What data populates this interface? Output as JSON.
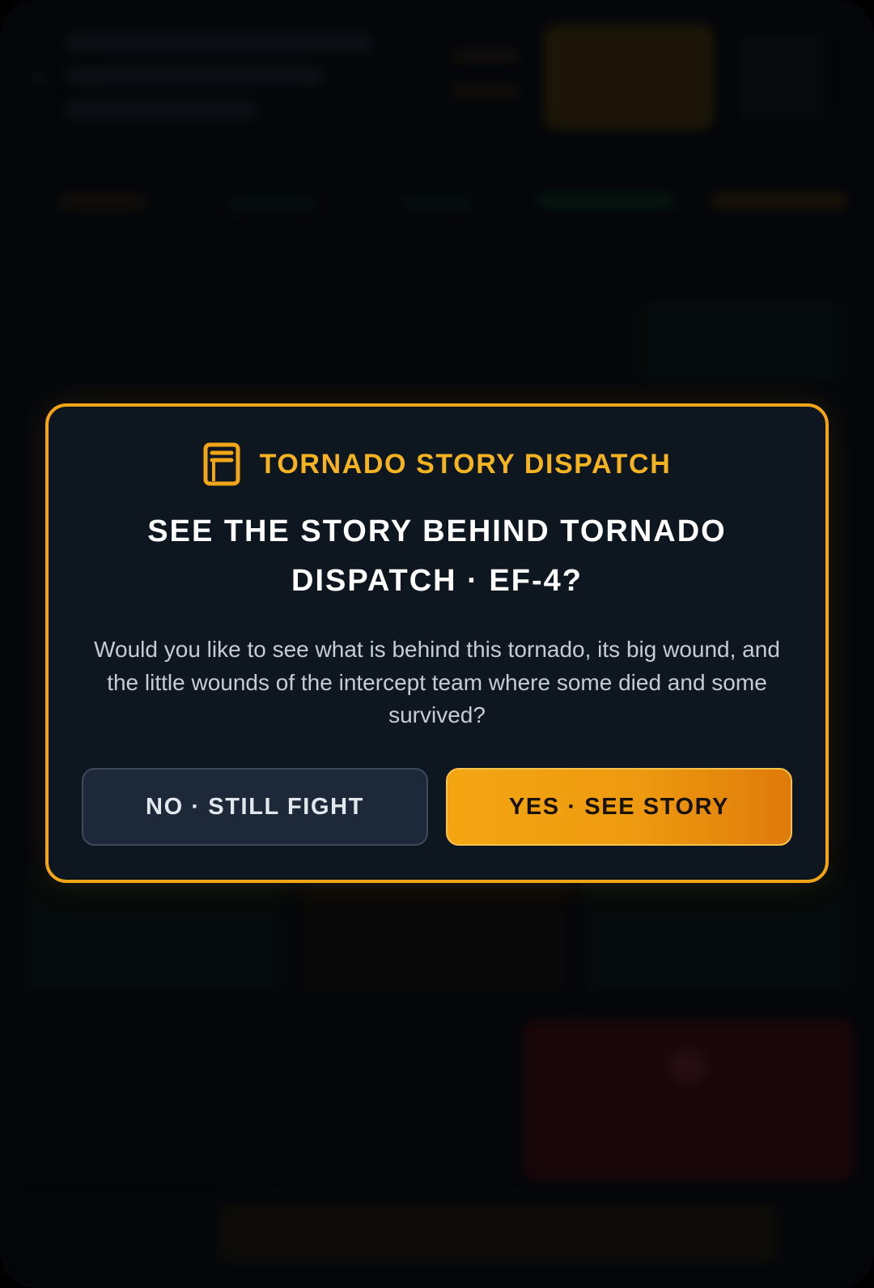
{
  "modal": {
    "icon": "book-icon",
    "kicker": "TORNADO STORY DISPATCH",
    "title": "SEE THE STORY BEHIND TORNADO DISPATCH · EF-4?",
    "body": "Would you like to see what is behind this tornado, its big wound, and the little wounds of the intercept team where some died and some survived?",
    "no_label": "NO · STILL FIGHT",
    "yes_label": "YES · SEE STORY"
  },
  "colors": {
    "accent": "#f2a516",
    "modal_bg": "#0e1620",
    "no_button_bg": "#1d2838",
    "danger": "#5a0d0d"
  }
}
